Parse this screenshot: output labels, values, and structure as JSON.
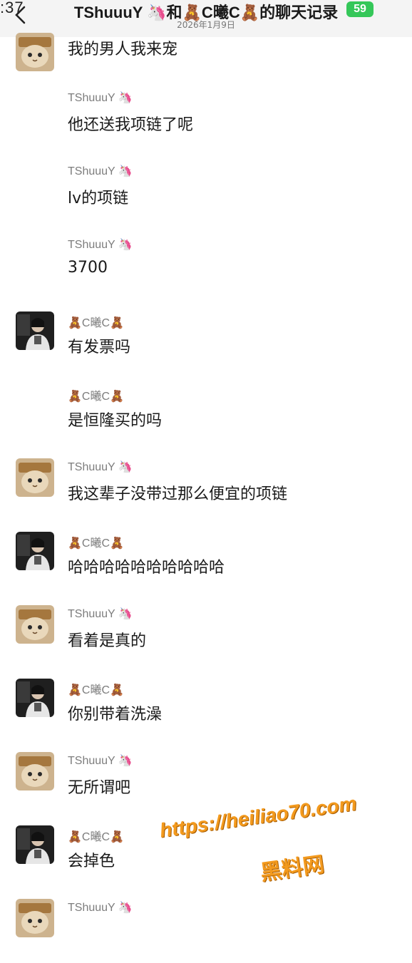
{
  "status_bar": {
    "time": ":37",
    "battery": "59"
  },
  "header": {
    "title": "TShuuuY 🦄和🧸C曦C🧸的聊天记录",
    "date": "2026年1月9日"
  },
  "messages": [
    {
      "sender": "",
      "avatar": "cat",
      "text": "我的男人我来宠"
    },
    {
      "sender": "TShuuuY 🦄",
      "avatar": "",
      "text": "他还送我项链了呢"
    },
    {
      "sender": "TShuuuY 🦄",
      "avatar": "",
      "text": "lv的项链"
    },
    {
      "sender": "TShuuuY 🦄",
      "avatar": "",
      "text": "3700"
    },
    {
      "sender": "🧸C曦C🧸",
      "avatar": "person",
      "text": "有发票吗"
    },
    {
      "sender": "🧸C曦C🧸",
      "avatar": "",
      "text": "是恒隆买的吗"
    },
    {
      "sender": "TShuuuY 🦄",
      "avatar": "cat",
      "text": "我这辈子没带过那么便宜的项链"
    },
    {
      "sender": "🧸C曦C🧸",
      "avatar": "person",
      "text": "哈哈哈哈哈哈哈哈哈哈"
    },
    {
      "sender": "TShuuuY 🦄",
      "avatar": "cat",
      "text": "看着是真的"
    },
    {
      "sender": "🧸C曦C🧸",
      "avatar": "person",
      "text": "你别带着洗澡"
    },
    {
      "sender": "TShuuuY 🦄",
      "avatar": "cat",
      "text": "无所谓吧"
    },
    {
      "sender": "🧸C曦C🧸",
      "avatar": "person",
      "text": "会掉色"
    },
    {
      "sender": "TShuuuY 🦄",
      "avatar": "cat",
      "text": ""
    }
  ],
  "watermark": {
    "url": "https://heiliao70.com",
    "name": "黑料网"
  }
}
